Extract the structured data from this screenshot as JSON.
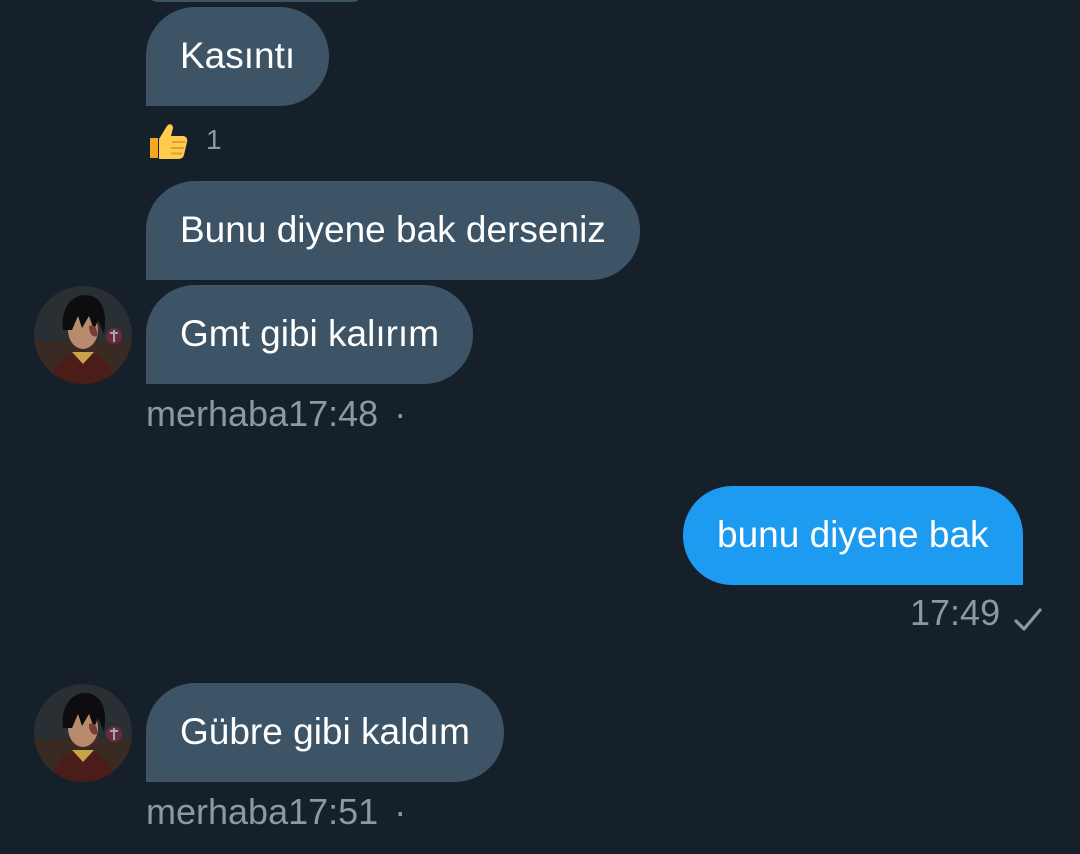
{
  "conversation": {
    "messages": [
      {
        "direction": "in",
        "text": "Kasıntı"
      },
      {
        "direction": "in",
        "text": "Bunu diyene bak derseniz"
      },
      {
        "direction": "in",
        "text": "Gmt gibi kalırım"
      },
      {
        "direction": "out",
        "text": "bunu diyene bak"
      },
      {
        "direction": "in",
        "text": "Gübre gibi kaldım"
      }
    ],
    "reaction": {
      "icon": "thumbs-up-icon",
      "count": "1"
    },
    "meta": [
      {
        "sender": "merhaba",
        "time": "17:48",
        "separator": "·"
      },
      {
        "time": "17:49",
        "status_icon": "check-icon"
      },
      {
        "sender": "merhaba",
        "time": "17:51",
        "separator": "·"
      }
    ]
  },
  "colors": {
    "background": "#15202b",
    "incoming_bubble": "#3d5466",
    "outgoing_bubble": "#1d9bf0",
    "meta_text": "#8b98a5"
  }
}
